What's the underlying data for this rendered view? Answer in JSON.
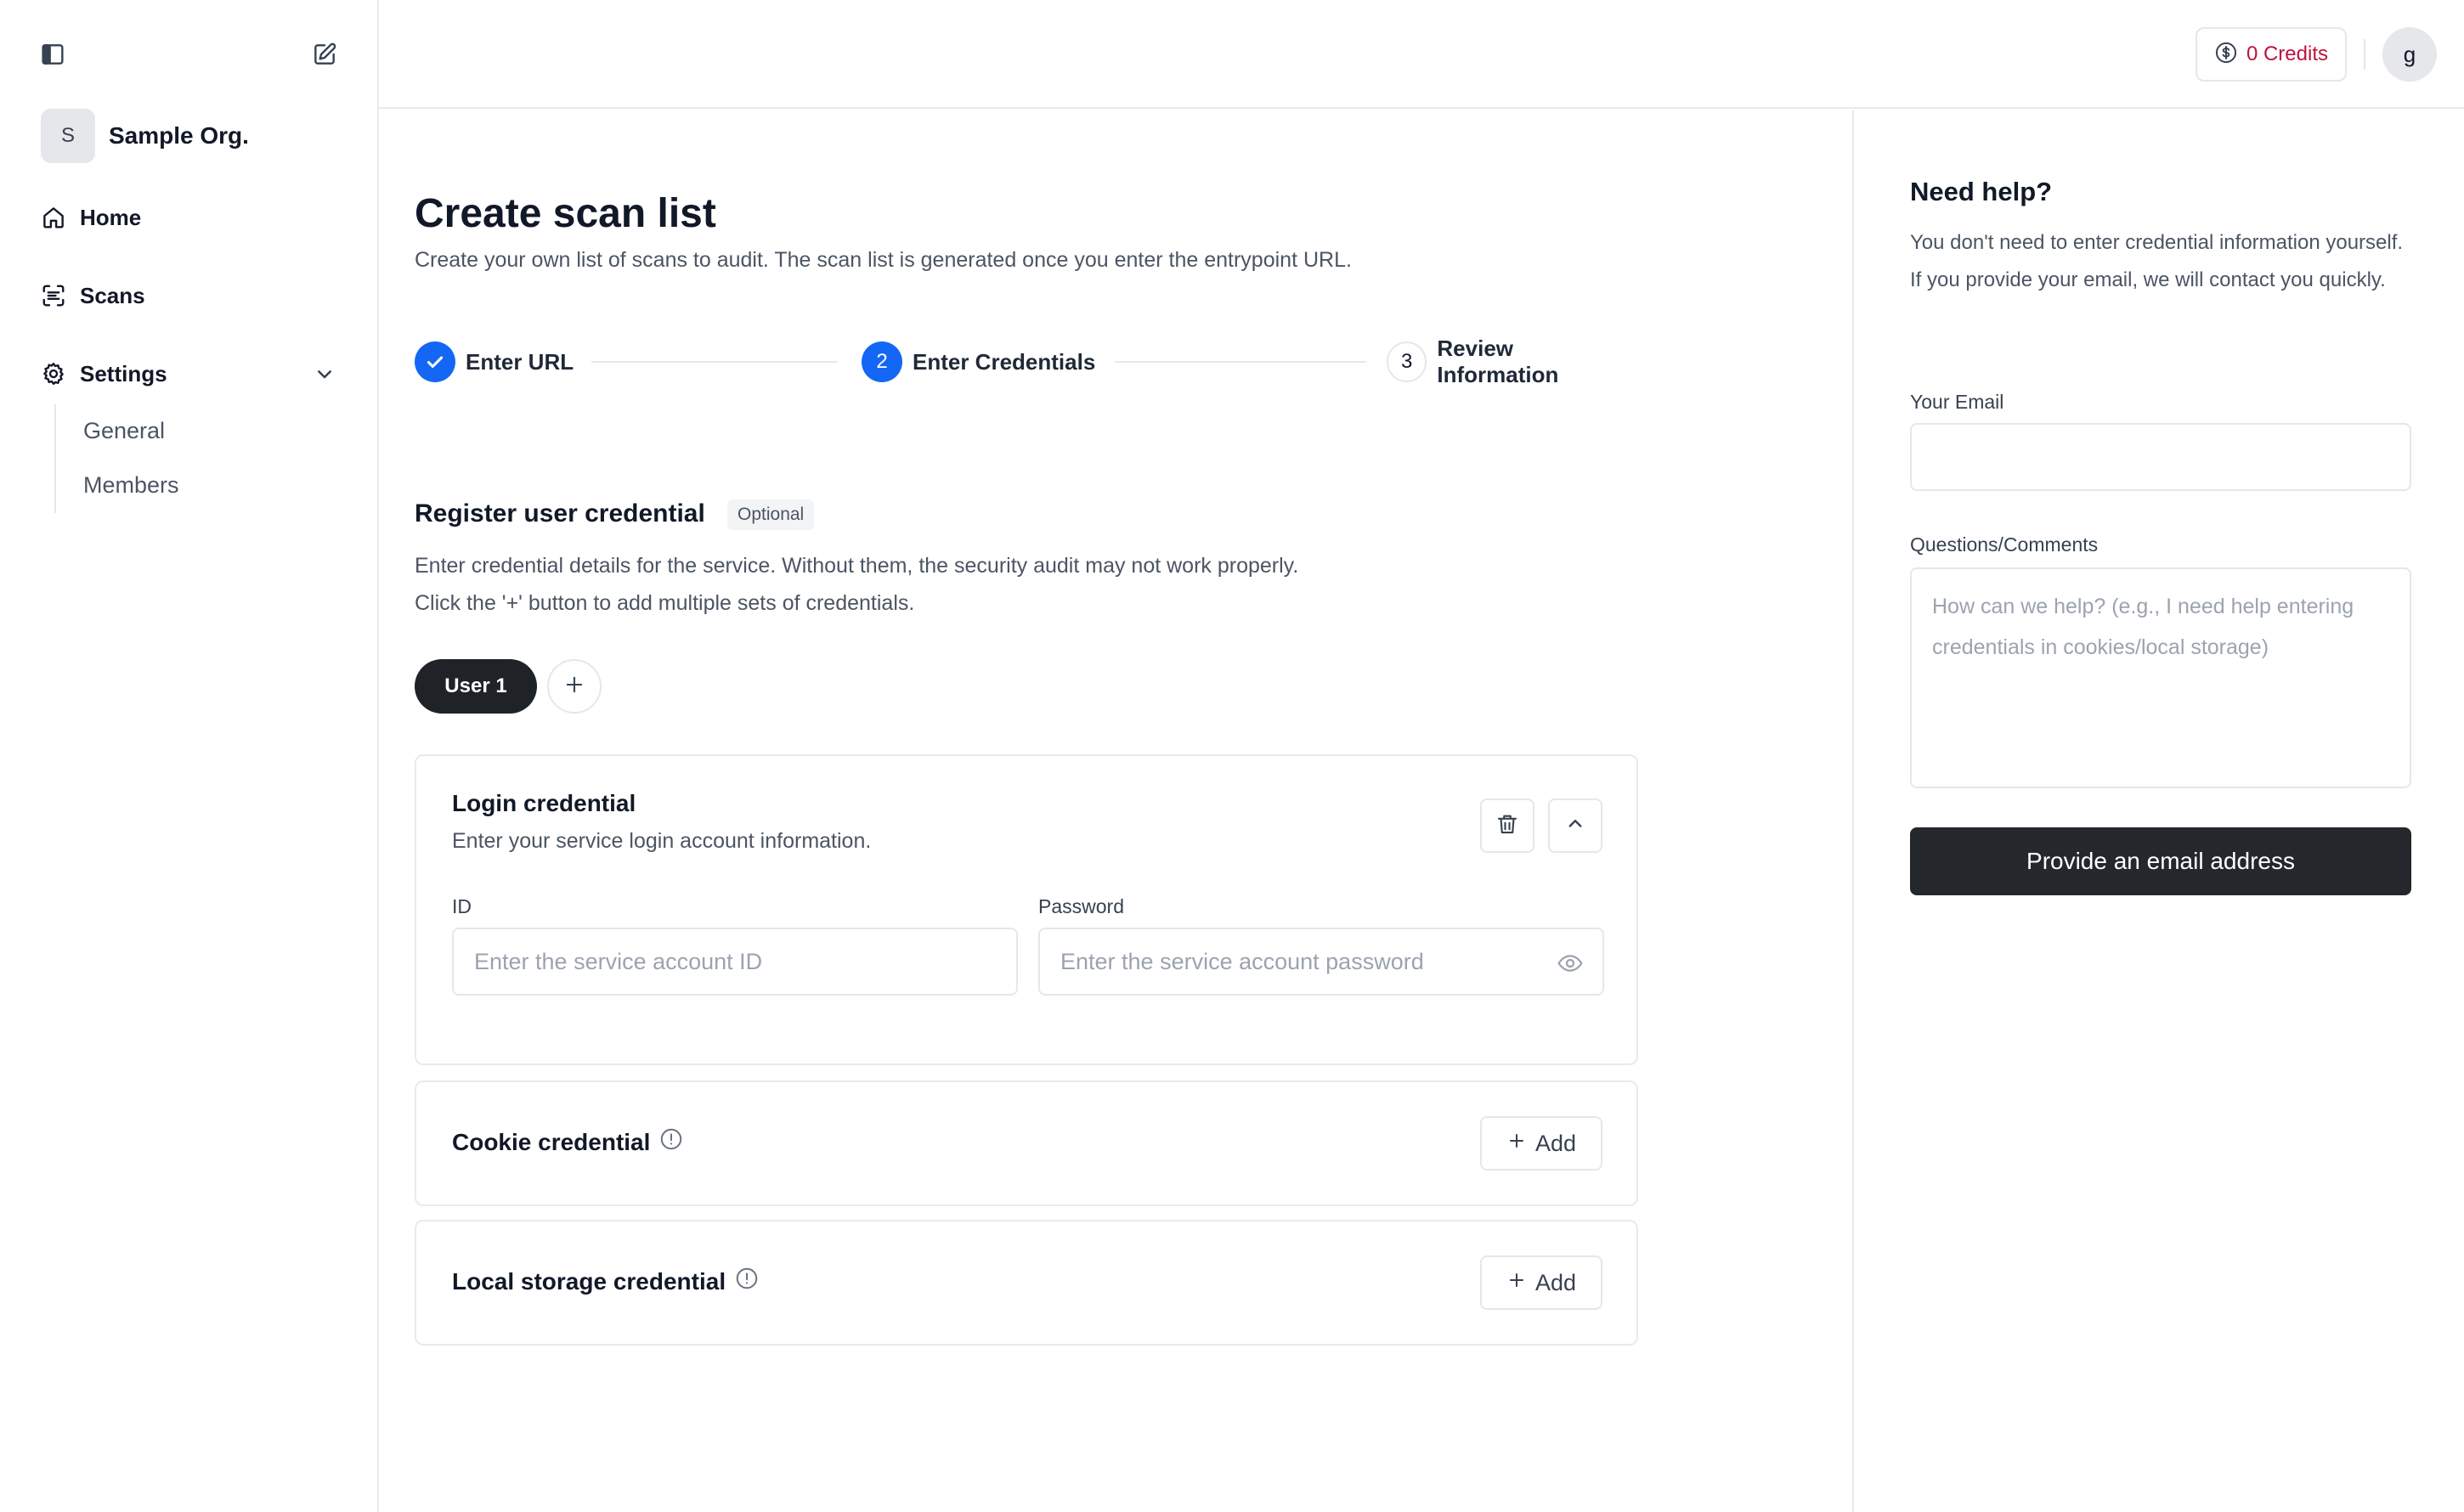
{
  "sidebar": {
    "org": {
      "initial": "S",
      "name": "Sample Org."
    },
    "nav": [
      {
        "label": "Home",
        "icon": "home-icon"
      },
      {
        "label": "Scans",
        "icon": "scan-icon"
      },
      {
        "label": "Settings",
        "icon": "gear-icon"
      }
    ],
    "settings_sub": [
      {
        "label": "General"
      },
      {
        "label": "Members"
      }
    ]
  },
  "topbar": {
    "credits_label": "0 Credits",
    "user_initial": "g"
  },
  "main": {
    "title": "Create scan list",
    "subtitle": "Create your own list of scans to audit. The scan list is generated once you enter the entrypoint URL.",
    "steps": [
      {
        "number": "1",
        "label": "Enter URL",
        "state": "done"
      },
      {
        "number": "2",
        "label": "Enter Credentials",
        "state": "active"
      },
      {
        "number": "3",
        "label": "Review Information",
        "state": "todo"
      }
    ],
    "register": {
      "title": "Register user credential",
      "badge": "Optional",
      "desc_line1": "Enter credential details for the service. Without them, the security audit may not work properly.",
      "desc_line2": "Click the '+' button to add multiple sets of credentials."
    },
    "user_tab": "User 1",
    "login": {
      "title": "Login credential",
      "desc": "Enter your service login account information.",
      "id_label": "ID",
      "id_placeholder": "Enter the service account ID",
      "password_label": "Password",
      "password_placeholder": "Enter the service account password"
    },
    "cookie": {
      "title": "Cookie credential",
      "add_label": "Add"
    },
    "local_storage": {
      "title": "Local storage credential",
      "add_label": "Add"
    }
  },
  "help": {
    "title": "Need help?",
    "desc": "You don't need to enter credential information yourself. If you provide your email, we will contact you quickly.",
    "email_label": "Your Email",
    "email_value": "",
    "comments_label": "Questions/Comments",
    "comments_placeholder": "How can we help? (e.g., I need help entering credentials in cookies/local storage)",
    "submit_label": "Provide an email address"
  },
  "colors": {
    "accent_blue": "#1467f5",
    "credits_red": "#be123c",
    "dark_button": "#24282d"
  }
}
